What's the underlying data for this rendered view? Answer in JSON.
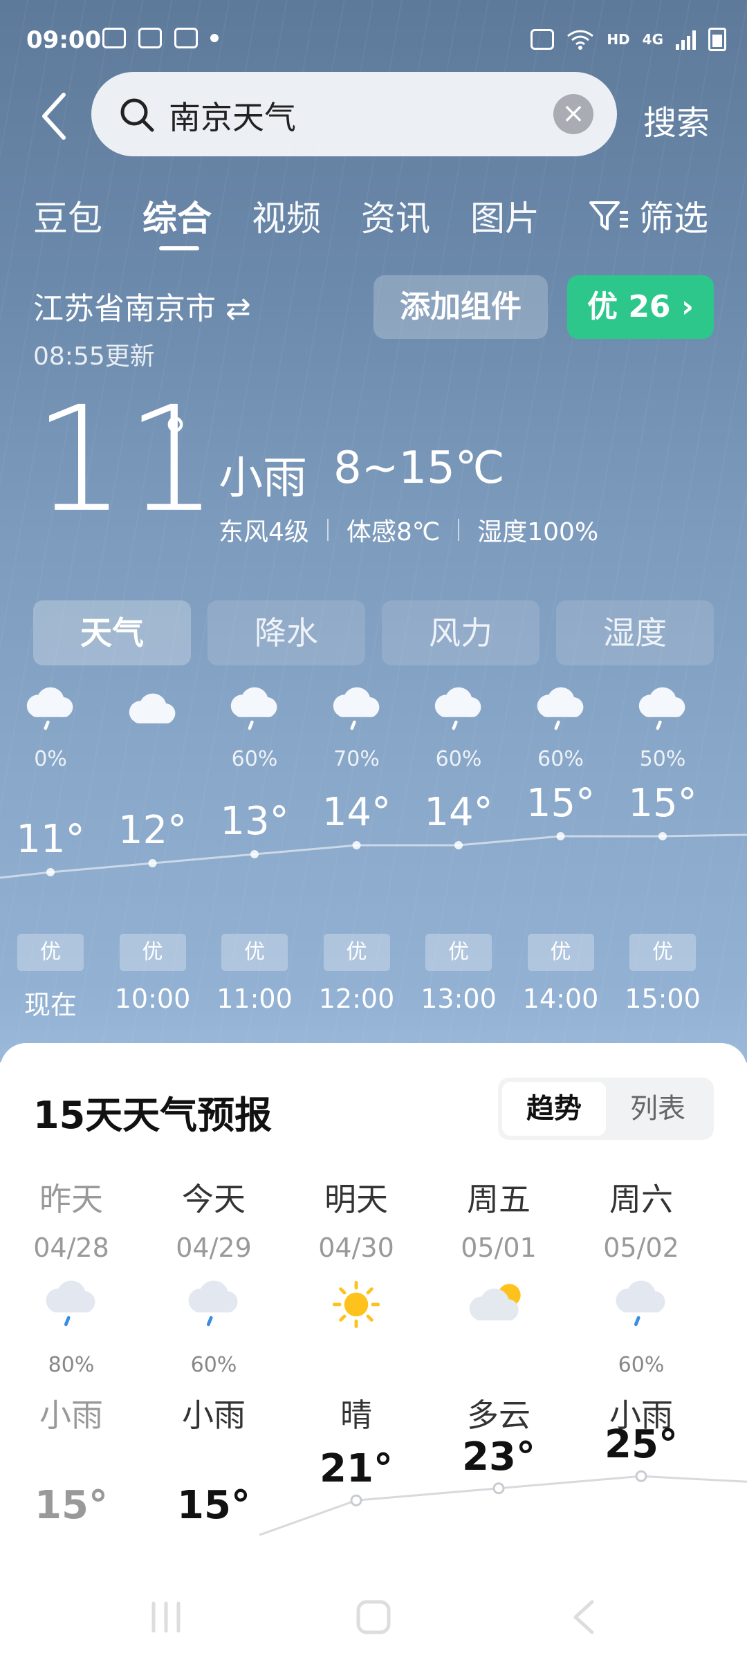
{
  "status_bar": {
    "time": "09:00",
    "hd_label": "HD",
    "network_label": "4G"
  },
  "header": {
    "search_query": "南京天气",
    "search_button": "搜索"
  },
  "tabs": [
    {
      "label": "豆包"
    },
    {
      "label": "综合",
      "active": true
    },
    {
      "label": "视频"
    },
    {
      "label": "资讯"
    },
    {
      "label": "图片"
    }
  ],
  "filter_label": "筛选",
  "location": {
    "city": "江苏省南京市",
    "updated": "08:55更新"
  },
  "buttons": {
    "add_widget": "添加组件",
    "aqi": "优 26 ›"
  },
  "current": {
    "temp": "11",
    "degree_symbol": "°",
    "condition": "小雨",
    "range": "8~15℃",
    "wind": "东风4级",
    "feels_like": "体感8℃",
    "humidity": "湿度100%"
  },
  "chips": [
    {
      "label": "天气",
      "active": true
    },
    {
      "label": "降水"
    },
    {
      "label": "风力"
    },
    {
      "label": "湿度"
    }
  ],
  "hourly": [
    {
      "time": "现在",
      "icon": "cloud-rain-icon",
      "pct": "0%",
      "temp": "11°",
      "value": 11,
      "aqi": "优"
    },
    {
      "time": "10:00",
      "icon": "cloud-icon",
      "pct": "",
      "temp": "12°",
      "value": 12,
      "aqi": "优"
    },
    {
      "time": "11:00",
      "icon": "cloud-rain-icon",
      "pct": "60%",
      "temp": "13°",
      "value": 13,
      "aqi": "优"
    },
    {
      "time": "12:00",
      "icon": "cloud-rain-icon",
      "pct": "70%",
      "temp": "14°",
      "value": 14,
      "aqi": "优"
    },
    {
      "time": "13:00",
      "icon": "cloud-rain-icon",
      "pct": "60%",
      "temp": "14°",
      "value": 14,
      "aqi": "优"
    },
    {
      "time": "14:00",
      "icon": "cloud-rain-icon",
      "pct": "60%",
      "temp": "15°",
      "value": 15,
      "aqi": "优"
    },
    {
      "time": "15:00",
      "icon": "cloud-rain-icon",
      "pct": "50%",
      "temp": "15°",
      "value": 15,
      "aqi": "优"
    }
  ],
  "forecast": {
    "title": "15天天气预报",
    "view_options": [
      {
        "label": "趋势",
        "active": true
      },
      {
        "label": "列表"
      }
    ],
    "days": [
      {
        "name": "昨天",
        "date": "04/28",
        "icon": "cloud-rain-icon",
        "pct": "80%",
        "condition": "小雨",
        "high": "15°",
        "high_value": 15,
        "past": true
      },
      {
        "name": "今天",
        "date": "04/29",
        "icon": "cloud-rain-icon",
        "pct": "60%",
        "condition": "小雨",
        "high": "15°",
        "high_value": 15
      },
      {
        "name": "明天",
        "date": "04/30",
        "icon": "sun-icon",
        "pct": "",
        "condition": "晴",
        "high": "21°",
        "high_value": 21
      },
      {
        "name": "周五",
        "date": "05/01",
        "icon": "partly-cloudy-icon",
        "pct": "",
        "condition": "多云",
        "high": "23°",
        "high_value": 23
      },
      {
        "name": "周六",
        "date": "05/02",
        "icon": "cloud-rain-icon",
        "pct": "60%",
        "condition": "小雨",
        "high": "25°",
        "high_value": 25
      }
    ]
  },
  "colors": {
    "aqi_green": "#2dc78c",
    "sky_top": "#5e7a9a",
    "sky_bottom": "#9bb9da"
  }
}
